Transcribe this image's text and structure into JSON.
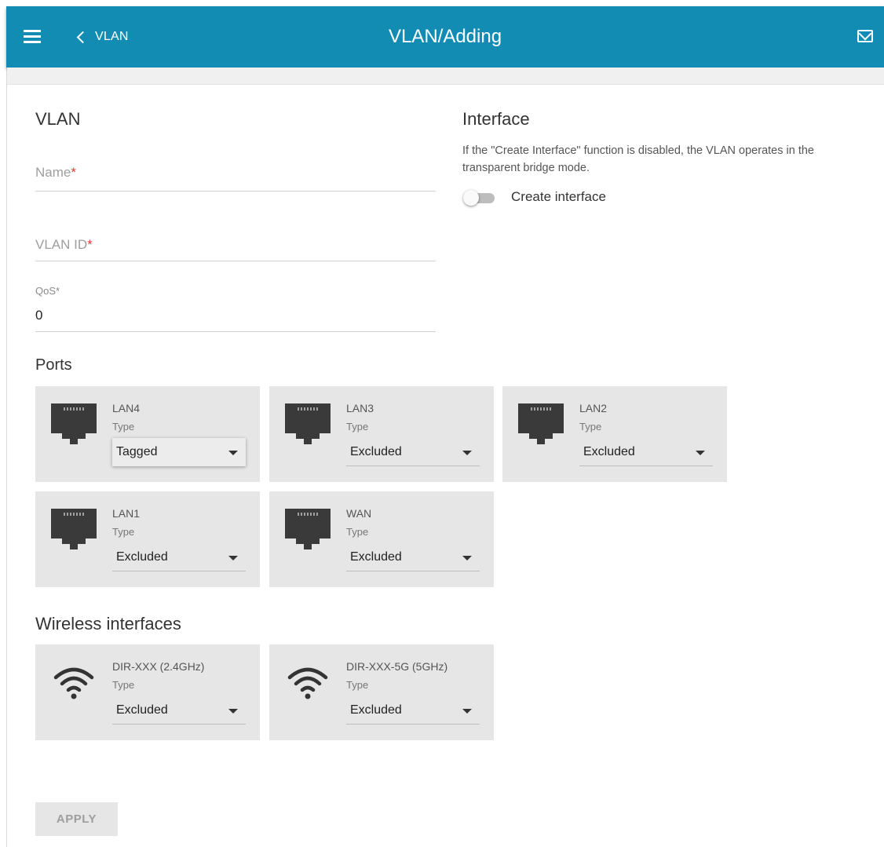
{
  "header": {
    "back_label": "VLAN",
    "title": "VLAN/Adding"
  },
  "vlan_section": {
    "title": "VLAN",
    "name_field": {
      "label": "Name",
      "required_mark": "*"
    },
    "vlan_id_field": {
      "label": "VLAN ID",
      "required_mark": "*"
    },
    "qos_field": {
      "label": "QoS",
      "required_mark": "*",
      "value": "0"
    }
  },
  "interface_section": {
    "title": "Interface",
    "description": "If the \"Create Interface\" function is disabled, the VLAN operates in the transparent bridge mode.",
    "toggle_label": "Create interface",
    "toggle_on": false
  },
  "ports_section": {
    "title": "Ports",
    "items": [
      {
        "name": "LAN4",
        "type_label": "Type",
        "value": "Tagged",
        "icon": "ethernet-port-icon"
      },
      {
        "name": "LAN3",
        "type_label": "Type",
        "value": "Excluded",
        "icon": "ethernet-port-icon"
      },
      {
        "name": "LAN2",
        "type_label": "Type",
        "value": "Excluded",
        "icon": "ethernet-port-icon"
      },
      {
        "name": "LAN1",
        "type_label": "Type",
        "value": "Excluded",
        "icon": "ethernet-port-icon"
      },
      {
        "name": "WAN",
        "type_label": "Type",
        "value": "Excluded",
        "icon": "ethernet-port-icon"
      }
    ]
  },
  "wireless_section": {
    "title": "Wireless interfaces",
    "items": [
      {
        "name": "DIR-XXX (2.4GHz)",
        "type_label": "Type",
        "value": "Excluded",
        "icon": "wifi-icon"
      },
      {
        "name": "DIR-XXX-5G (5GHz)",
        "type_label": "Type",
        "value": "Excluded",
        "icon": "wifi-icon"
      }
    ]
  },
  "actions": {
    "apply_label": "APPLY"
  },
  "colors": {
    "header_bg": "#138cb4",
    "card_bg": "#e6e6e6",
    "required": "#e53935"
  }
}
